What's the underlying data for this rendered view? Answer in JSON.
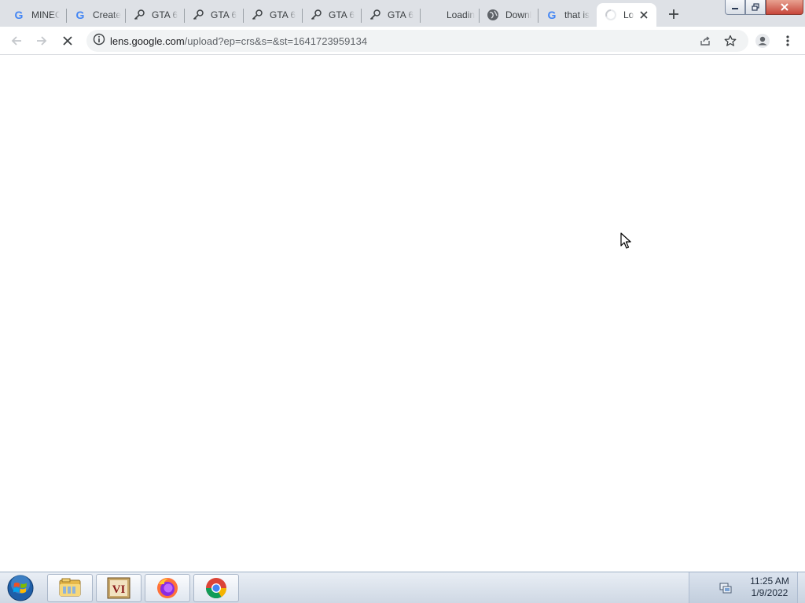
{
  "browser": {
    "tabs": [
      {
        "title": "MINEC",
        "icon": "google-g-icon",
        "active": false
      },
      {
        "title": "Create",
        "icon": "google-g-icon",
        "active": false
      },
      {
        "title": "GTA 6",
        "icon": "key-icon",
        "active": false
      },
      {
        "title": "GTA 6",
        "icon": "key-icon",
        "active": false
      },
      {
        "title": "GTA 6",
        "icon": "key-icon",
        "active": false
      },
      {
        "title": "GTA 6",
        "icon": "key-icon",
        "active": false
      },
      {
        "title": "GTA 6",
        "icon": "key-icon",
        "active": false
      },
      {
        "title": "Loadin",
        "icon": "blank-icon",
        "active": false
      },
      {
        "title": "Downl",
        "icon": "globe-icon",
        "active": false
      },
      {
        "title": "that is",
        "icon": "google-g-icon",
        "active": false
      },
      {
        "title": "Lo",
        "icon": "loading-spinner-icon",
        "active": true
      }
    ],
    "url": {
      "host": "lens.google.com",
      "path": "/upload?ep=crs&s=&st=1641723959134"
    },
    "page_state": "loading"
  },
  "taskbar": {
    "apps": [
      {
        "name": "windows-explorer",
        "icon": "folder-icon"
      },
      {
        "name": "vi-app",
        "icon": "vi-icon",
        "label": "VI"
      },
      {
        "name": "firefox",
        "icon": "firefox-icon"
      },
      {
        "name": "chrome",
        "icon": "chrome-icon"
      }
    ],
    "clock": {
      "time": "11:25 AM",
      "date": "1/9/2022"
    }
  },
  "colors": {
    "tabstrip_bg": "#dee1e6",
    "omnibox_bg": "#f1f3f4",
    "google_blue": "#4285f4"
  }
}
